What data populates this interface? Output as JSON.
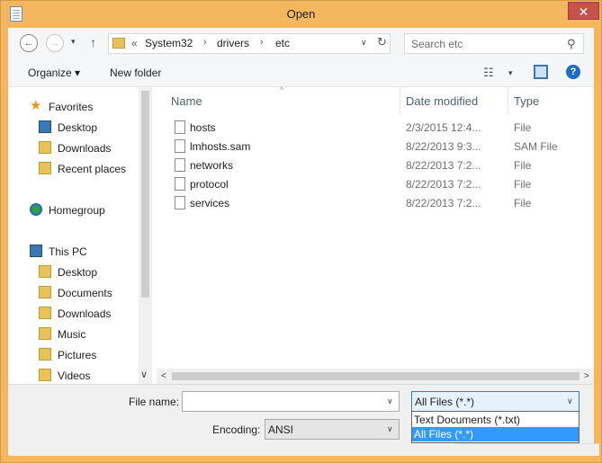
{
  "window": {
    "title": "Open",
    "close_glyph": "✕"
  },
  "address_bar": {
    "back_glyph": "←",
    "forward_glyph": "→",
    "recent_glyph": "▾",
    "up_glyph": "↑",
    "overflow_glyph": "«",
    "crumbs": [
      "System32",
      "drivers",
      "etc"
    ],
    "crumb_sep": "›",
    "dropdown_glyph": "∨",
    "refresh_glyph": "↻"
  },
  "search": {
    "placeholder": "Search etc",
    "icon_glyph": "⚲"
  },
  "toolbar": {
    "organize_label": "Organize ▾",
    "new_folder_label": "New folder",
    "view_glyph": "☷",
    "view_drop_glyph": "▾",
    "help_glyph": "?"
  },
  "nav_pane": {
    "items": [
      {
        "label": "Favorites",
        "icon": "star-icon"
      },
      {
        "label": "Desktop",
        "icon": "desktop-icon"
      },
      {
        "label": "Downloads",
        "icon": "downloads-icon"
      },
      {
        "label": "Recent places",
        "icon": "recent-places-icon"
      },
      {
        "label": "Homegroup",
        "icon": "homegroup-icon"
      },
      {
        "label": "This PC",
        "icon": "this-pc-icon"
      },
      {
        "label": "Desktop",
        "icon": "folder-icon"
      },
      {
        "label": "Documents",
        "icon": "folder-icon"
      },
      {
        "label": "Downloads",
        "icon": "folder-icon"
      },
      {
        "label": "Music",
        "icon": "folder-icon"
      },
      {
        "label": "Pictures",
        "icon": "folder-icon"
      },
      {
        "label": "Videos",
        "icon": "folder-icon"
      }
    ],
    "scroll_down_glyph": "∨"
  },
  "file_list": {
    "columns": {
      "name": "Name",
      "date": "Date modified",
      "type": "Type"
    },
    "sort_glyph": "^",
    "rows": [
      {
        "name": "hosts",
        "date": "2/3/2015 12:4...",
        "type": "File"
      },
      {
        "name": "lmhosts.sam",
        "date": "8/22/2013 9:3...",
        "type": "SAM File"
      },
      {
        "name": "networks",
        "date": "8/22/2013 7:2...",
        "type": "File"
      },
      {
        "name": "protocol",
        "date": "8/22/2013 7:2...",
        "type": "File"
      },
      {
        "name": "services",
        "date": "8/22/2013 7:2...",
        "type": "File"
      }
    ],
    "scroll_left_glyph": "<",
    "scroll_right_glyph": ">"
  },
  "bottom": {
    "file_name_label": "File name:",
    "file_name_value": "",
    "file_type_value": "All Files  (*.*)",
    "encoding_label": "Encoding:",
    "encoding_value": "ANSI",
    "dropdown_glyph": "∨"
  },
  "file_type_dropdown": {
    "options": [
      "Text Documents (*.txt)",
      "All Files  (*.*)"
    ],
    "selected_index": 1
  },
  "colors": {
    "title_bar": "#f4b75f",
    "selection": "#3399ff",
    "close_button": "#c75050"
  }
}
